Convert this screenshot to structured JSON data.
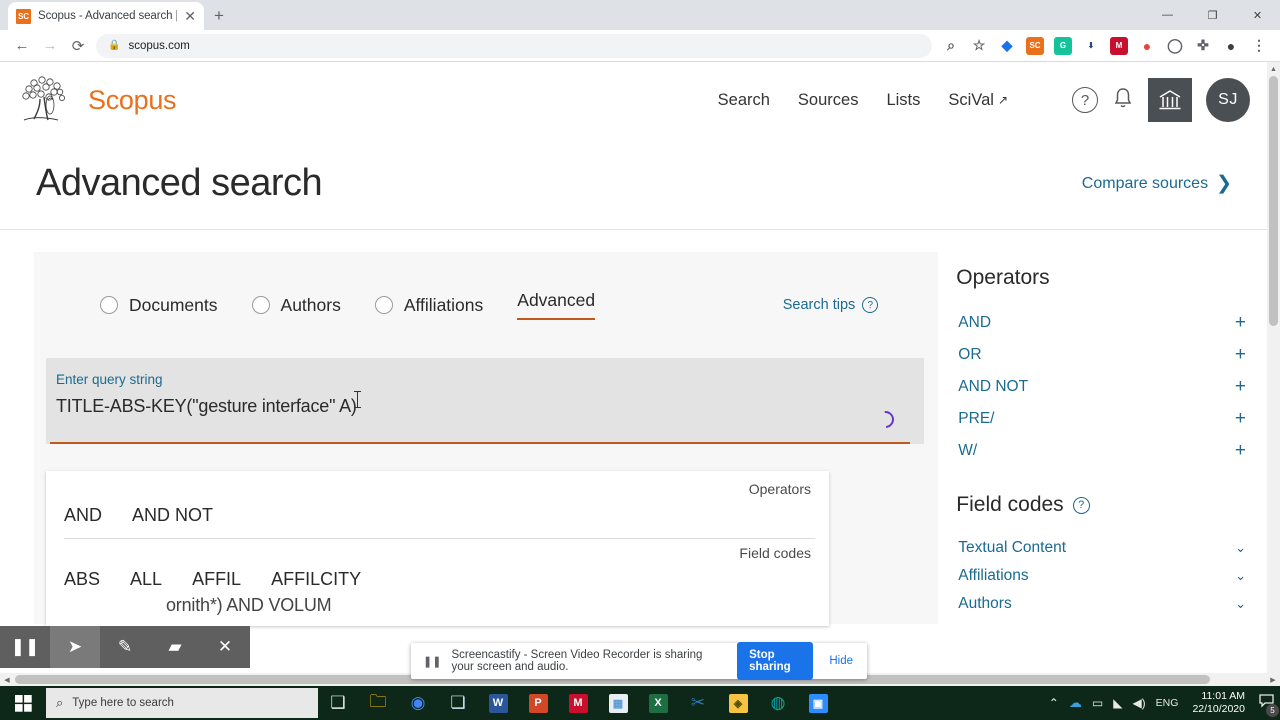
{
  "browser": {
    "tab": {
      "title": "Scopus - Advanced search | Signed",
      "favicon_label": "SC",
      "close_label": "✕"
    },
    "newtab_label": "+",
    "window_controls": {
      "minimize": "—",
      "maximize": "❐",
      "close": "✕"
    },
    "nav": {
      "back": "←",
      "forward": "→",
      "reload": "⟳"
    },
    "omnibox": {
      "lock": "🔒",
      "url": "scopus.com"
    },
    "toolbar_icons": [
      {
        "name": "zoom-icon",
        "glyph": "⌕",
        "color": "#5f6368",
        "bg": "transparent"
      },
      {
        "name": "bookmark-star-icon",
        "glyph": "☆",
        "color": "#5f6368",
        "bg": "transparent"
      },
      {
        "name": "extension-blue-diamond-icon",
        "glyph": "◆",
        "color": "#1a73e8",
        "bg": "transparent"
      },
      {
        "name": "scopus-extension-icon",
        "glyph": "SC",
        "color": "#ffffff",
        "bg": "#e9711c"
      },
      {
        "name": "grammarly-extension-icon",
        "glyph": "G",
        "color": "#ffffff",
        "bg": "#15c39a"
      },
      {
        "name": "download-extension-icon",
        "glyph": "⬇",
        "color": "#2a4a8a",
        "bg": "#ffffff"
      },
      {
        "name": "mendeley-extension-icon",
        "glyph": "M",
        "color": "#ffffff",
        "bg": "#c8102e"
      },
      {
        "name": "snip-extension-icon",
        "glyph": "●",
        "color": "#e8453c",
        "bg": "transparent"
      },
      {
        "name": "circle-extension-icon",
        "glyph": "◯",
        "color": "#5f6368",
        "bg": "transparent"
      },
      {
        "name": "puzzle-extensions-icon",
        "glyph": "✜",
        "color": "#5f6368",
        "bg": "transparent"
      },
      {
        "name": "profile-avatar-icon",
        "glyph": "●",
        "color": "#3c4043",
        "bg": "transparent"
      },
      {
        "name": "chrome-menu-icon",
        "glyph": "⋮",
        "color": "#5f6368",
        "bg": "transparent"
      }
    ]
  },
  "scopus": {
    "brand": "Scopus",
    "nav_links": [
      "Search",
      "Sources",
      "Lists",
      "SciVal"
    ],
    "scival_arrow": "↗",
    "header_icons": {
      "help": "?",
      "notifications": "bell-icon",
      "institution": "institution-icon",
      "avatar_initials": "SJ"
    },
    "page_title": "Advanced search",
    "compare_sources": "Compare sources",
    "compare_chevron": "❯"
  },
  "search_card": {
    "tabs": [
      {
        "label": "Documents",
        "selected": false
      },
      {
        "label": "Authors",
        "selected": false
      },
      {
        "label": "Affiliations",
        "selected": false
      },
      {
        "label": "Advanced",
        "selected": true
      }
    ],
    "search_tips": "Search tips",
    "search_tips_help": "?",
    "query_label": "Enter query string",
    "query_value": "TITLE-ABS-KEY(\"gesture interface\" A)",
    "loading": true,
    "hidden_query_fragment": "ornith*) AND VOLUM",
    "autocomplete": {
      "operators_header": "Operators",
      "operators": [
        "AND",
        "AND NOT"
      ],
      "fieldcodes_header": "Field codes",
      "fieldcodes": [
        "ABS",
        "ALL",
        "AFFIL",
        "AFFILCITY"
      ]
    }
  },
  "sidebar": {
    "operators_title": "Operators",
    "operators": [
      {
        "label": "AND",
        "action": "+"
      },
      {
        "label": "OR",
        "action": "+"
      },
      {
        "label": "AND NOT",
        "action": "+"
      },
      {
        "label": "PRE/",
        "action": "+"
      },
      {
        "label": "W/",
        "action": "+"
      }
    ],
    "fieldcodes_title": "Field codes",
    "fieldcodes_help": "?",
    "fieldcodes": [
      {
        "label": "Textual Content",
        "action": "⌄"
      },
      {
        "label": "Affiliations",
        "action": "⌄"
      },
      {
        "label": "Authors",
        "action": "⌄"
      }
    ]
  },
  "screencastify": {
    "buttons": [
      {
        "name": "pause-recording-button",
        "glyph": "❚❚",
        "active": false
      },
      {
        "name": "pointer-tool-button",
        "glyph": "➤",
        "active": true
      },
      {
        "name": "pen-tool-button",
        "glyph": "✎",
        "active": false
      },
      {
        "name": "eraser-tool-button",
        "glyph": "▰",
        "active": false
      },
      {
        "name": "close-toolbar-button",
        "glyph": "✕",
        "active": false
      }
    ],
    "share_notice": "Screencastify - Screen Video Recorder is sharing your screen and audio.",
    "stop_label": "Stop sharing",
    "hide_label": "Hide",
    "pause_glyph": "❚❚"
  },
  "taskbar": {
    "start_label": "⊞",
    "search_placeholder": "Type here to search",
    "search_icon": "⌕",
    "apps": [
      {
        "name": "task-view-button",
        "glyph": "❑",
        "color": "#e8e8e8",
        "bg": "transparent"
      },
      {
        "name": "file-explorer-app",
        "glyph": "🗀",
        "color": "#ffc107",
        "bg": "transparent"
      },
      {
        "name": "chrome-app",
        "glyph": "◉",
        "color": "#4285f4",
        "bg": "transparent"
      },
      {
        "name": "onenote-app",
        "glyph": "❏",
        "color": "#cfe8f5",
        "bg": "transparent"
      },
      {
        "name": "word-app",
        "glyph": "W",
        "color": "#ffffff",
        "bg": "#2b579a"
      },
      {
        "name": "powerpoint-app",
        "glyph": "P",
        "color": "#ffffff",
        "bg": "#d24726"
      },
      {
        "name": "mendeley-app",
        "glyph": "M",
        "color": "#ffffff",
        "bg": "#c8102e"
      },
      {
        "name": "calculator-app",
        "glyph": "▦",
        "color": "#5b9bd5",
        "bg": "#e8eef4"
      },
      {
        "name": "excel-app",
        "glyph": "X",
        "color": "#ffffff",
        "bg": "#1d6f42"
      },
      {
        "name": "snipping-tool-app",
        "glyph": "✂",
        "color": "#2a7ab0",
        "bg": "transparent"
      },
      {
        "name": "sticky-notes-app",
        "glyph": "◈",
        "color": "#5a4a00",
        "bg": "#f5c542"
      },
      {
        "name": "teal-circle-app",
        "glyph": "◍",
        "color": "#0fa3a3",
        "bg": "transparent"
      },
      {
        "name": "zoom-meeting-app",
        "glyph": "▣",
        "color": "#ffffff",
        "bg": "#2d8cff"
      }
    ],
    "tray": {
      "chevron": "⌃",
      "onedrive": "☁",
      "battery": "▭",
      "wifi": "◣",
      "volume": "◀)",
      "language": "ENG",
      "time": "11:01 AM",
      "date": "22/10/2020",
      "notification_count": "5"
    }
  }
}
